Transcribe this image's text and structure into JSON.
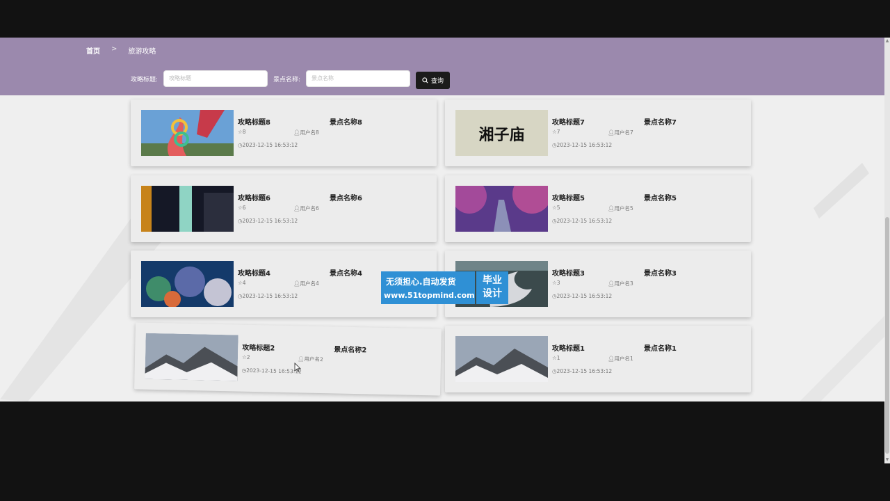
{
  "breadcrumb": {
    "home": "首页",
    "separator": ">",
    "current": "旅游攻略"
  },
  "search": {
    "title_label": "攻略标题:",
    "title_placeholder": "攻略标题",
    "spot_label": "景点名称:",
    "spot_placeholder": "景点名称",
    "button_label": "查询"
  },
  "cards": [
    {
      "title": "攻略标题8",
      "spot": "景点名称8",
      "likes": "8",
      "user": "用户名8",
      "time": "2023-12-15 16:53:12",
      "image": "colorful-sculpture"
    },
    {
      "title": "攻略标题7",
      "spot": "景点名称7",
      "likes": "7",
      "user": "用户名7",
      "time": "2023-12-15 16:53:12",
      "image": "calligraphy-sign",
      "image_text": "湘子庙"
    },
    {
      "title": "攻略标题6",
      "spot": "景点名称6",
      "likes": "6",
      "user": "用户名6",
      "time": "2023-12-15 16:53:12",
      "image": "night-street"
    },
    {
      "title": "攻略标题5",
      "spot": "景点名称5",
      "likes": "5",
      "user": "用户名5",
      "time": "2023-12-15 16:53:12",
      "image": "purple-blossom-path"
    },
    {
      "title": "攻略标题4",
      "spot": "景点名称4",
      "likes": "4",
      "user": "用户名4",
      "time": "2023-12-15 16:53:12",
      "image": "coral-reef"
    },
    {
      "title": "攻略标题3",
      "spot": "景点名称3",
      "likes": "3",
      "user": "用户名3",
      "time": "2023-12-15 16:53:12",
      "image": "steel-sculpture"
    },
    {
      "title": "攻略标题2",
      "spot": "景点名称2",
      "likes": "2",
      "user": "用户名2",
      "time": "2023-12-15 16:53:12",
      "image": "snow-mountain"
    },
    {
      "title": "攻略标题1",
      "spot": "景点名称1",
      "likes": "1",
      "user": "用户名1",
      "time": "2023-12-15 16:53:12",
      "image": "snow-mountain"
    }
  ],
  "watermark": {
    "line1": "无须担心.自动发货",
    "line2": "www.51topmind.com",
    "badge_line1": "毕业",
    "badge_line2": "设计"
  },
  "colors": {
    "header": "#9b89ad",
    "button": "#1b1b1b",
    "watermark": "#2f90d5",
    "page_bg": "#efefef"
  }
}
